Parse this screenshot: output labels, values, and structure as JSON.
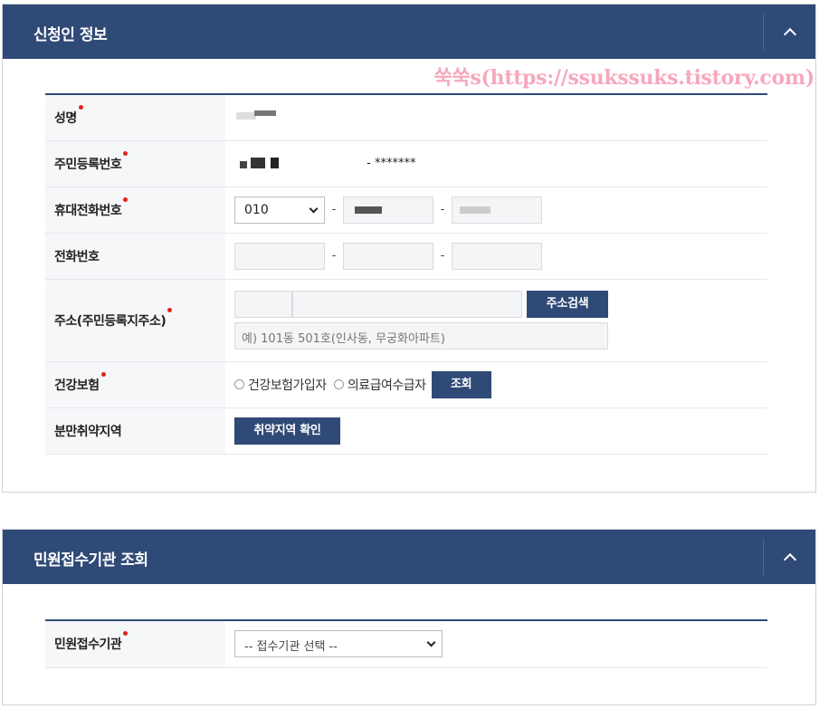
{
  "watermark": "쑥쑥s(https://ssukssuks.tistory.com)",
  "applicant": {
    "title": "신청인 정보",
    "name_label": "성명",
    "rrn_label": "주민등록번호",
    "rrn_masked": "- *******",
    "mobile_label": "휴대전화번호",
    "mobile_prefix": "010",
    "dash": "-",
    "phone_label": "전화번호",
    "address_label": "주소(주민등록지주소)",
    "address_search": "주소검색",
    "address_placeholder": "예) 101동 501호(인사동, 무궁화아파트)",
    "insurance_label": "건강보험",
    "insurance_opt1": "건강보험가입자",
    "insurance_opt2": "의료급여수급자",
    "insurance_btn": "조회",
    "region_label": "분만취약지역",
    "region_btn": "취약지역 확인"
  },
  "office": {
    "title": "민원접수기관 조회",
    "label": "민원접수기관",
    "select_value": "-- 접수기관 선택 --"
  }
}
